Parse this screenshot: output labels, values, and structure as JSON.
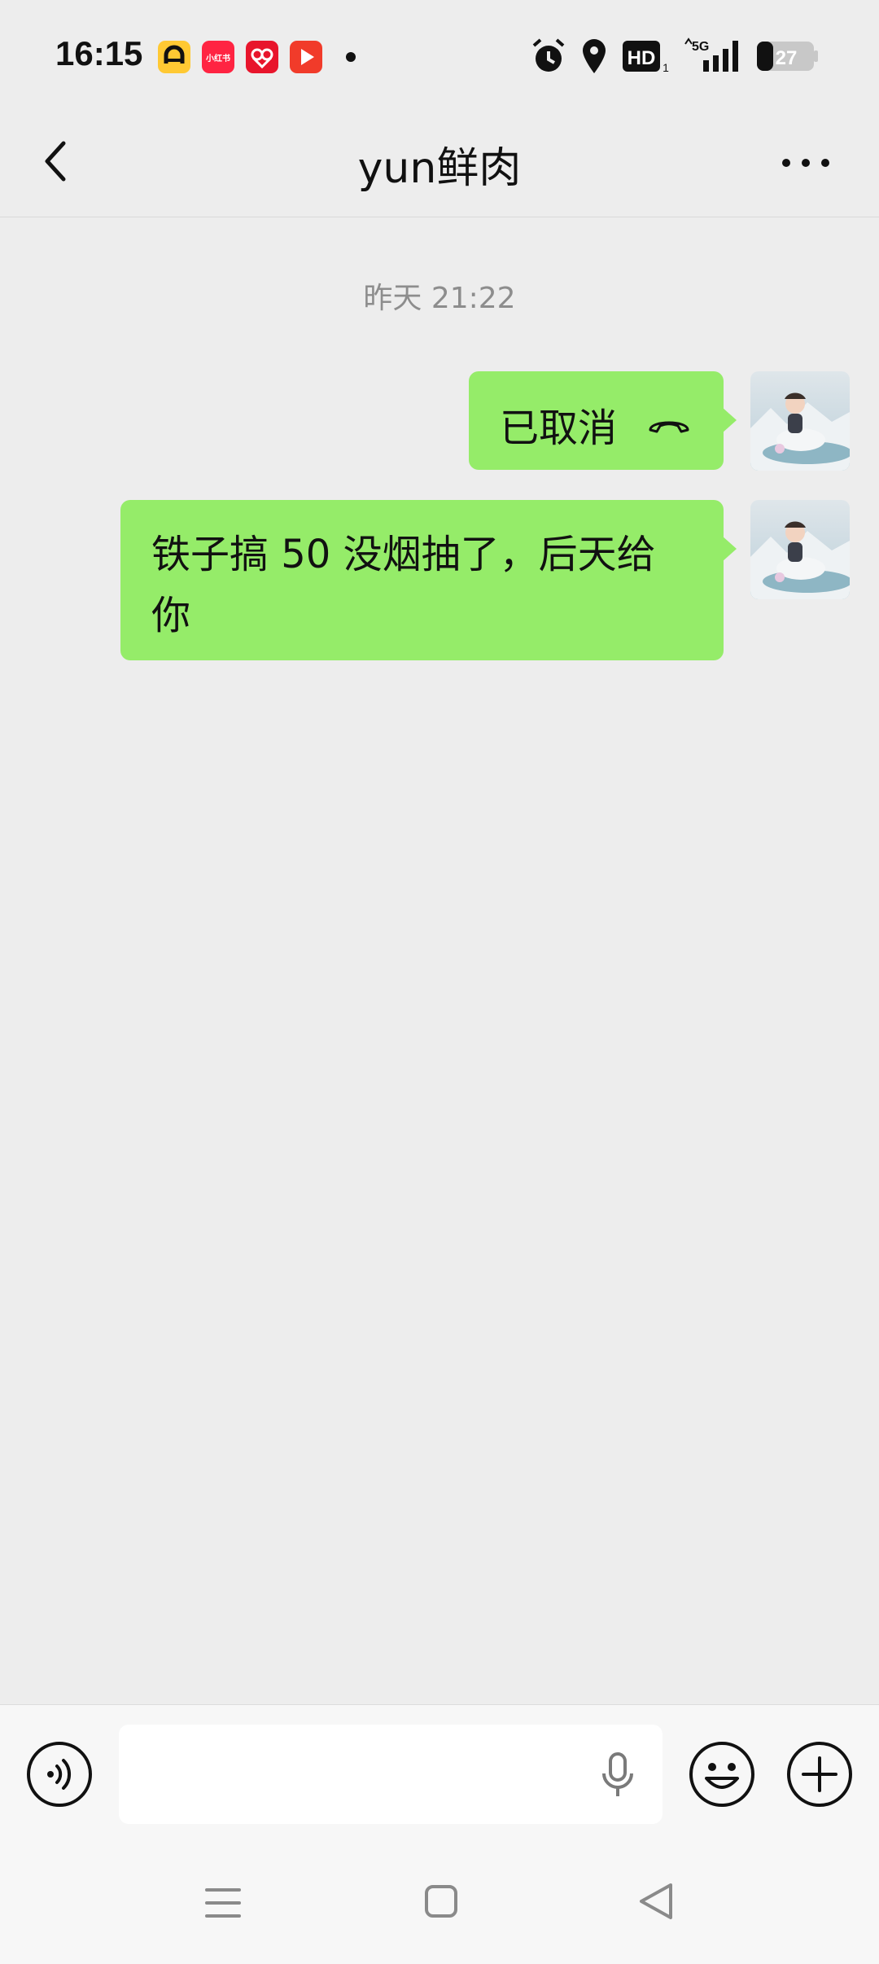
{
  "status_bar": {
    "time": "16:15",
    "notification_icons": [
      "chat-app-icon",
      "xiaohongshu-icon",
      "gift-app-icon",
      "video-app-icon"
    ],
    "xiaohongshu_label": "小红书",
    "network": "5G",
    "hd_label": "HD",
    "hd_sub": "1",
    "battery": "27"
  },
  "title_bar": {
    "title": "yun鲜肉"
  },
  "messages": {
    "timestamp": "昨天 21:22",
    "items": [
      {
        "sender": "me",
        "text": "已取消",
        "type": "call-cancelled"
      },
      {
        "sender": "me",
        "text": "铁子搞 50 没烟抽了，后天给你",
        "type": "text"
      }
    ]
  },
  "input_bar": {
    "value": "",
    "placeholder": ""
  },
  "colors": {
    "background": "#ededed",
    "bubble": "#95ec69",
    "timestamp": "#8d8d8d",
    "bar": "#f7f7f7"
  }
}
